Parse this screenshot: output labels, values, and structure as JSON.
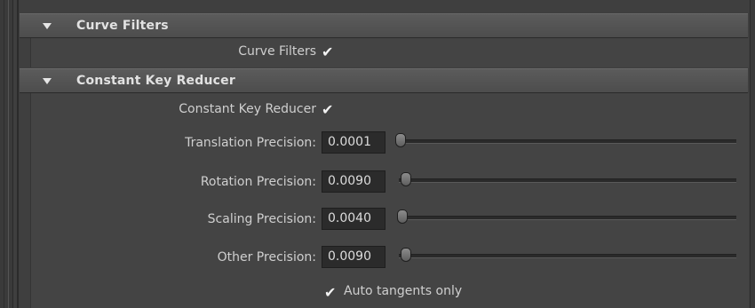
{
  "sections": {
    "curve_filters": {
      "title": "Curve Filters",
      "checkbox_label": "Curve Filters",
      "checked": true
    },
    "constant_key_reducer": {
      "title": "Constant Key Reducer",
      "checkbox_label": "Constant Key Reducer",
      "checked": true,
      "fields": {
        "translation": {
          "label": "Translation Precision:",
          "value": "0.0001"
        },
        "rotation": {
          "label": "Rotation Precision:",
          "value": "0.0090"
        },
        "scaling": {
          "label": "Scaling Precision:",
          "value": "0.0040"
        },
        "other": {
          "label": "Other Precision:",
          "value": "0.0090"
        }
      },
      "auto_tangents_label": "Auto tangents only",
      "auto_tangents_checked": true
    }
  },
  "icons": {
    "expand": "triangle-down-icon",
    "check": "checkmark-icon"
  },
  "colors": {
    "background": "#444444",
    "header": "#555555",
    "field": "#2b2b2b"
  }
}
